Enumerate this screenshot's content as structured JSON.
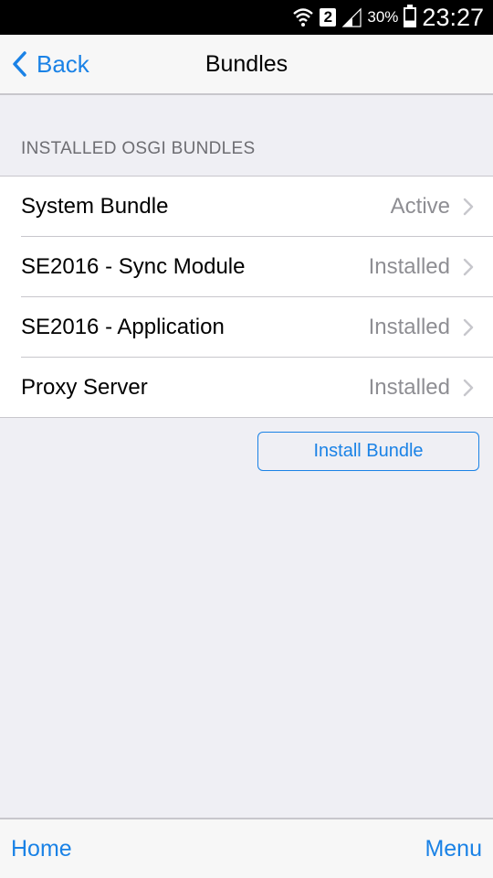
{
  "status_bar": {
    "sim_number": "2",
    "battery_percent": "30%",
    "time": "23:27"
  },
  "nav": {
    "back_label": "Back",
    "title": "Bundles"
  },
  "section": {
    "header": "INSTALLED OSGI BUNDLES"
  },
  "bundles": [
    {
      "name": "System Bundle",
      "status": "Active"
    },
    {
      "name": "SE2016 - Sync Module",
      "status": "Installed"
    },
    {
      "name": "SE2016 - Application",
      "status": "Installed"
    },
    {
      "name": "Proxy Server",
      "status": "Installed"
    }
  ],
  "actions": {
    "install_label": "Install Bundle"
  },
  "toolbar": {
    "home_label": "Home",
    "menu_label": "Menu"
  },
  "colors": {
    "accent": "#1a82e6",
    "background": "#efeff4",
    "secondary_text": "#8e8e93"
  }
}
